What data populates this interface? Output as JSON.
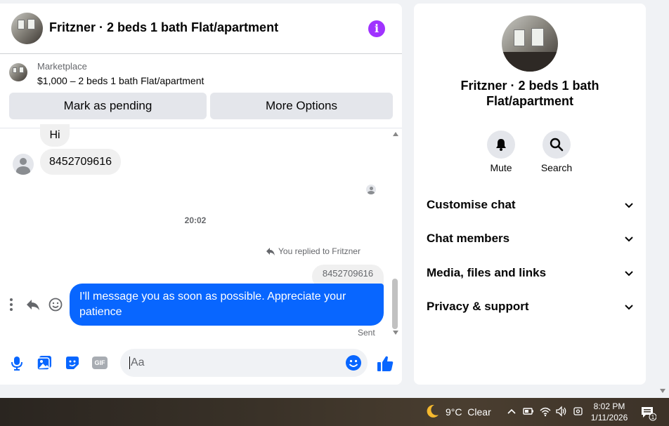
{
  "chat": {
    "title": "Fritzner · 2 beds 1 bath Flat/apartment",
    "marketplace_label": "Marketplace",
    "listing": "$1,000 – 2 beds 1 bath Flat/apartment",
    "mark_pending_label": "Mark as pending",
    "more_options_label": "More Options",
    "messages": {
      "hi": "Hi",
      "phone": "8452709616",
      "timestamp": "20:02",
      "replied_to": "You replied to Fritzner",
      "quoted": "8452709616",
      "outgoing": "I'll message you as soon as possible. Appreciate your patience",
      "status": "Sent"
    },
    "composer": {
      "placeholder": "Aa"
    },
    "colors": {
      "accent": "#0866ff",
      "info": "#a033ff"
    }
  },
  "info_panel": {
    "title": "Fritzner · 2 beds 1 bath Flat/apartment",
    "mute_label": "Mute",
    "search_label": "Search",
    "sections": [
      "Customise chat",
      "Chat members",
      "Media, files and links",
      "Privacy & support"
    ]
  },
  "taskbar": {
    "temperature": "9°C",
    "condition": "Clear",
    "time": "8:02 PM",
    "date": "1/11/2026",
    "notification_count": "1"
  },
  "icons": [
    "info-icon",
    "reply-icon",
    "more-icon",
    "react-icon",
    "mic-icon",
    "photo-icon",
    "sticker-icon",
    "gif-icon",
    "emoji-icon",
    "like-icon",
    "bell-icon",
    "search-icon",
    "chevron-down-icon",
    "moon-icon",
    "wifi-icon",
    "volume-icon",
    "battery-icon",
    "notification-icon"
  ]
}
